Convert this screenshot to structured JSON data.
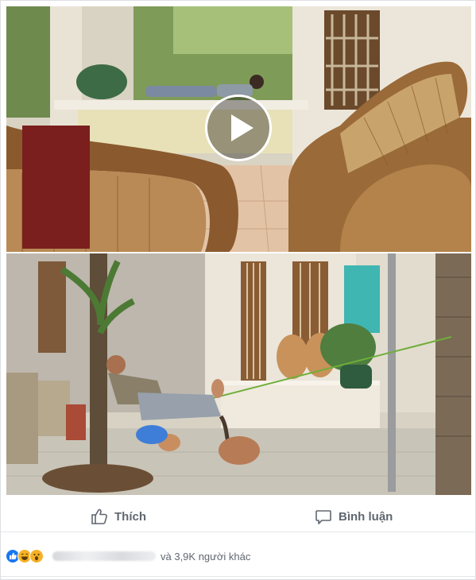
{
  "post": {
    "video": {
      "play_icon": "play-icon"
    },
    "photo": {}
  },
  "actions": {
    "like_label": "Thích",
    "like_icon": "thumbs-up-icon",
    "comment_label": "Bình luận",
    "comment_icon": "speech-bubble-icon"
  },
  "reactions": {
    "icons": [
      "like-reaction-icon",
      "haha-reaction-icon",
      "wow-reaction-icon"
    ],
    "summary": "và 3,9K người khác"
  },
  "colors": {
    "like_blue": "#1877f2",
    "reaction_yellow": "#f7b125",
    "text_gray": "#606770"
  }
}
